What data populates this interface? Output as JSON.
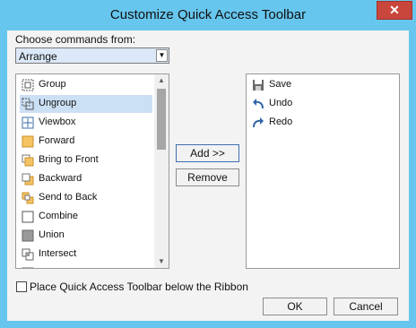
{
  "window": {
    "title": "Customize Quick Access Toolbar",
    "close_glyph": "✕"
  },
  "commands_label": "Choose commands from:",
  "combo": {
    "value": "Arrange",
    "arrow": "▼"
  },
  "left_list": {
    "items": [
      {
        "label": "Group",
        "icon": "group-icon",
        "selected": false
      },
      {
        "label": "Ungroup",
        "icon": "ungroup-icon",
        "selected": true
      },
      {
        "label": "Viewbox",
        "icon": "viewbox-icon",
        "selected": false
      },
      {
        "label": "Forward",
        "icon": "forward-icon",
        "selected": false
      },
      {
        "label": "Bring to Front",
        "icon": "bring-to-front-icon",
        "selected": false
      },
      {
        "label": "Backward",
        "icon": "backward-icon",
        "selected": false
      },
      {
        "label": "Send to Back",
        "icon": "send-to-back-icon",
        "selected": false
      },
      {
        "label": "Combine",
        "icon": "combine-icon",
        "selected": false
      },
      {
        "label": "Union",
        "icon": "union-icon",
        "selected": false
      },
      {
        "label": "Intersect",
        "icon": "intersect-icon",
        "selected": false
      }
    ]
  },
  "buttons": {
    "add": "Add >>",
    "remove": "Remove",
    "ok": "OK",
    "cancel": "Cancel"
  },
  "right_list": {
    "items": [
      {
        "label": "Save",
        "icon": "save-icon"
      },
      {
        "label": "Undo",
        "icon": "undo-icon"
      },
      {
        "label": "Redo",
        "icon": "redo-icon"
      }
    ]
  },
  "checkbox": {
    "label": "Place Quick Access Toolbar below the Ribbon",
    "checked": false
  },
  "scroll": {
    "up": "▲",
    "down": "▼"
  },
  "colors": {
    "accent": "#67c6ee",
    "close": "#c9463d",
    "selection": "#cce0f5"
  }
}
